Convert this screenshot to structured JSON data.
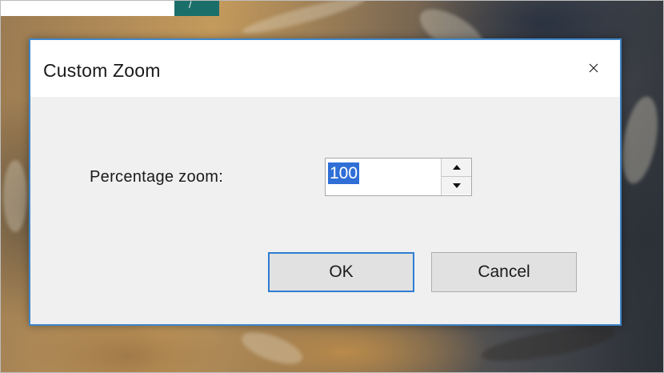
{
  "dialog": {
    "title": "Custom Zoom",
    "close_icon": "close-icon"
  },
  "zoom_field": {
    "label": "Percentage zoom:",
    "value": "100",
    "increment_icon": "triangle-up-icon",
    "decrement_icon": "triangle-down-icon"
  },
  "buttons": {
    "ok_label": "OK",
    "cancel_label": "Cancel"
  },
  "colors": {
    "dialog_border": "#3f86c8",
    "selection": "#2f6fd6",
    "default_button_border": "#2f7dd1",
    "background_accent": "#1b6f6a"
  }
}
